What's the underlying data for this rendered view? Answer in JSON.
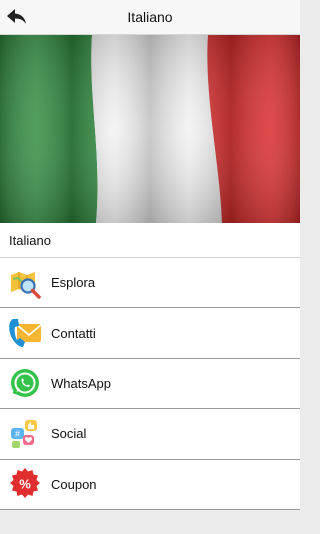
{
  "header": {
    "title": "Italiano",
    "back_icon": "back-arrow-icon"
  },
  "hero": {
    "subject": "Italian flag",
    "colors": [
      "#2e8b3d",
      "#f2f2f2",
      "#d92b2b"
    ]
  },
  "section": {
    "label": "Italiano"
  },
  "menu": [
    {
      "label": "Esplora",
      "icon": "explore-map-icon"
    },
    {
      "label": "Contatti",
      "icon": "contacts-icon"
    },
    {
      "label": "WhatsApp",
      "icon": "whatsapp-icon"
    },
    {
      "label": "Social",
      "icon": "social-icon"
    },
    {
      "label": "Coupon",
      "icon": "coupon-icon"
    }
  ]
}
